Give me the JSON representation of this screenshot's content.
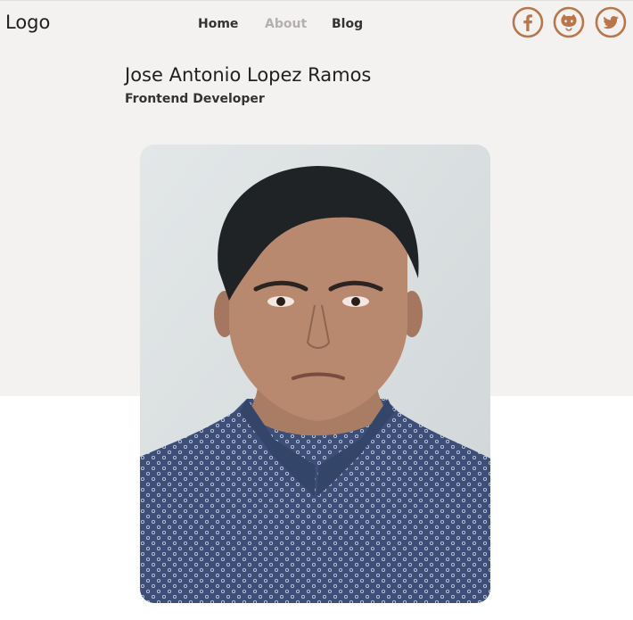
{
  "header": {
    "logo": "Logo",
    "nav": [
      {
        "label": "Home"
      },
      {
        "label": "About"
      },
      {
        "label": "Blog"
      }
    ],
    "social": [
      {
        "icon": "facebook-icon"
      },
      {
        "icon": "github-icon"
      },
      {
        "icon": "twitter-icon"
      }
    ],
    "accent_color": "#b8764a"
  },
  "hero": {
    "name": "Jose Antonio Lopez Ramos",
    "role": "Frontend Developer"
  }
}
